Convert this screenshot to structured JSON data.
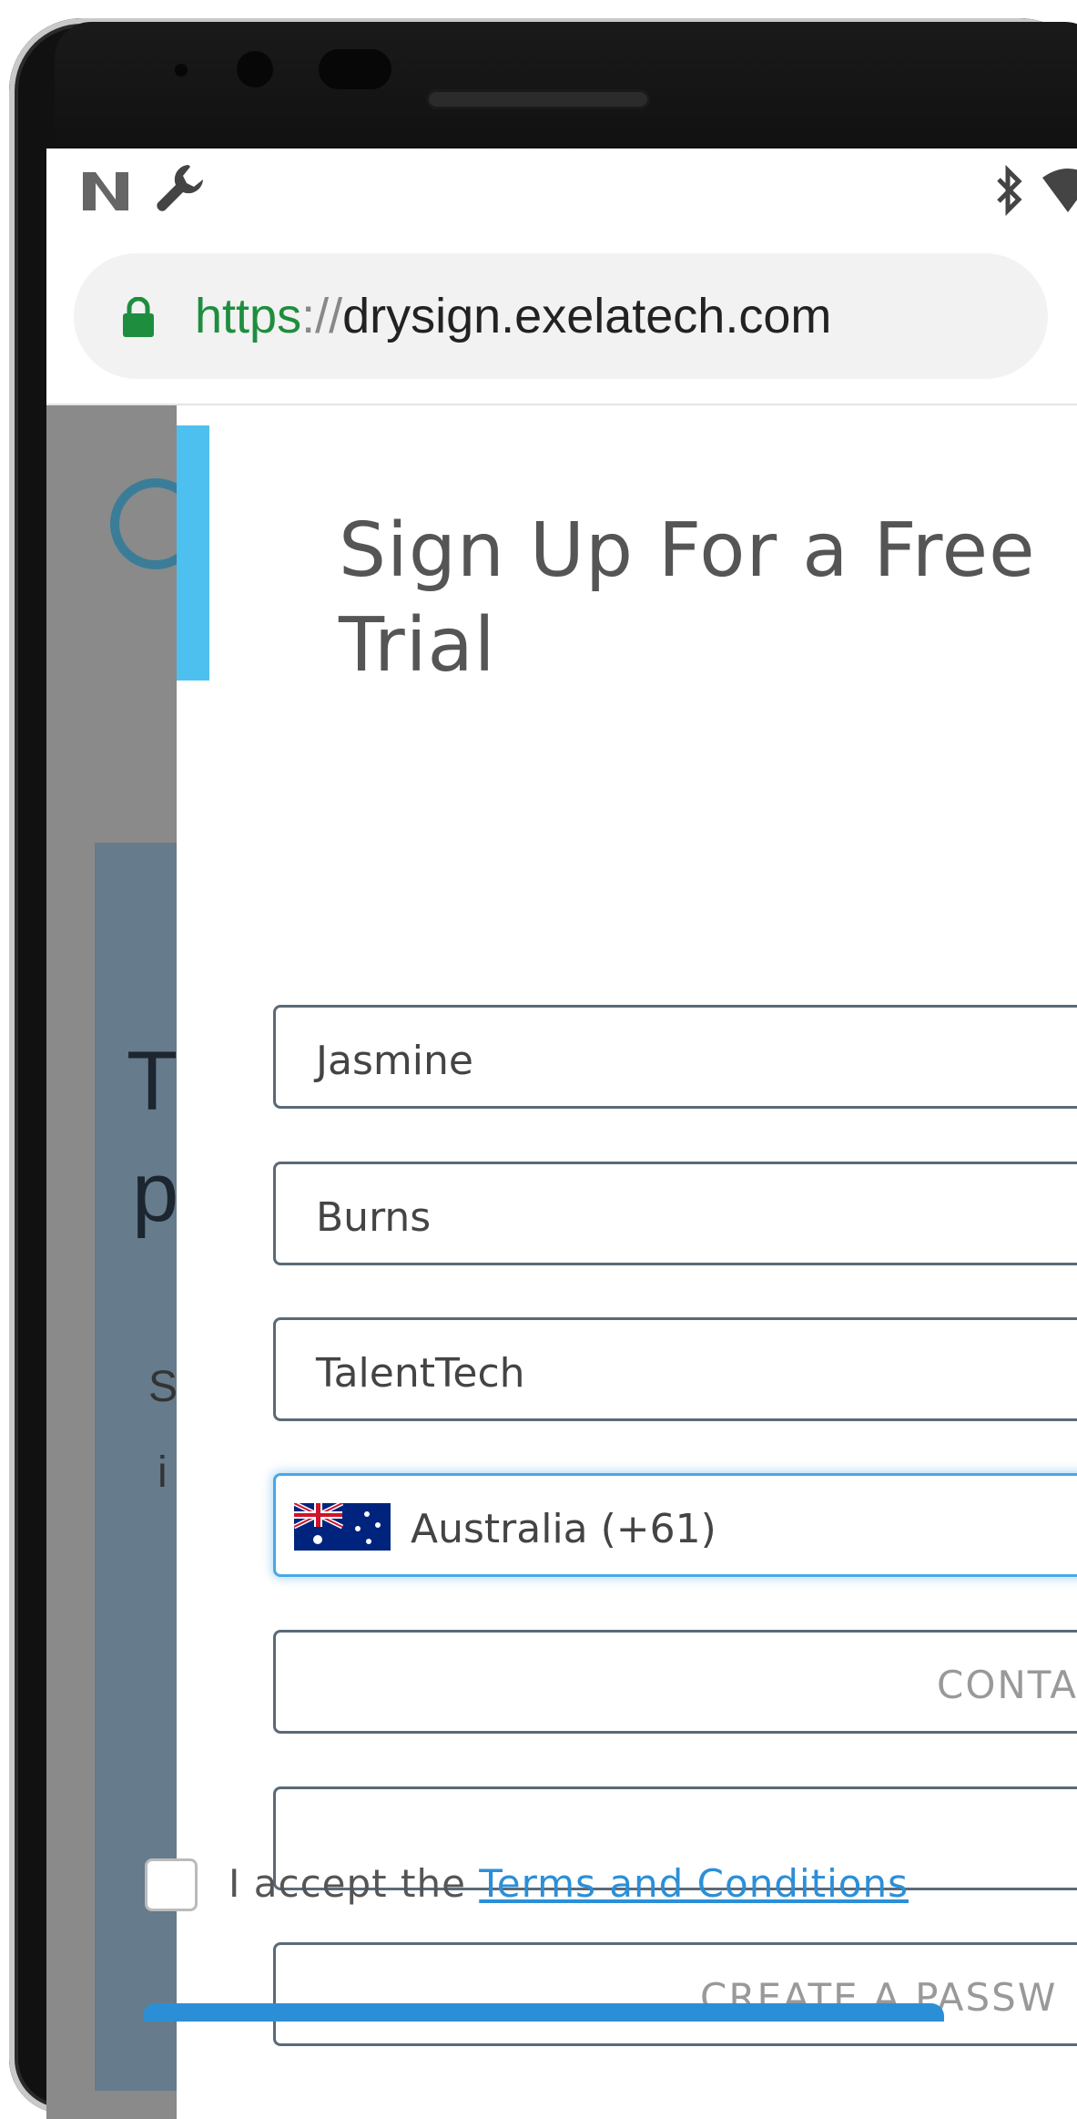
{
  "browser": {
    "url_scheme": "https",
    "url_separator": "://",
    "url_host": "drysign.exelatech.com"
  },
  "status_bar": {
    "left_icons": [
      "n-icon",
      "wrench-icon"
    ],
    "right_icons": [
      "bluetooth-icon",
      "wifi-icon"
    ]
  },
  "background_page": {
    "letters": [
      "T",
      "p",
      "S",
      "i"
    ]
  },
  "modal": {
    "title": "Sign Up For a Free Trial",
    "fields": {
      "first_name": "Jasmine",
      "last_name": "Burns",
      "company": "TalentTech",
      "country": "Australia (+61)",
      "contact_placeholder": "CONTA",
      "email_value": "",
      "password_placeholder": "CREATE A PASSW"
    },
    "terms_prefix": "I accept the",
    "terms_link": "Terms and Conditions"
  },
  "colors": {
    "accent": "#4ec0ef",
    "link": "#2b8fd8",
    "secure_green": "#1e8e3e",
    "focus_border": "#4aa8e6"
  }
}
